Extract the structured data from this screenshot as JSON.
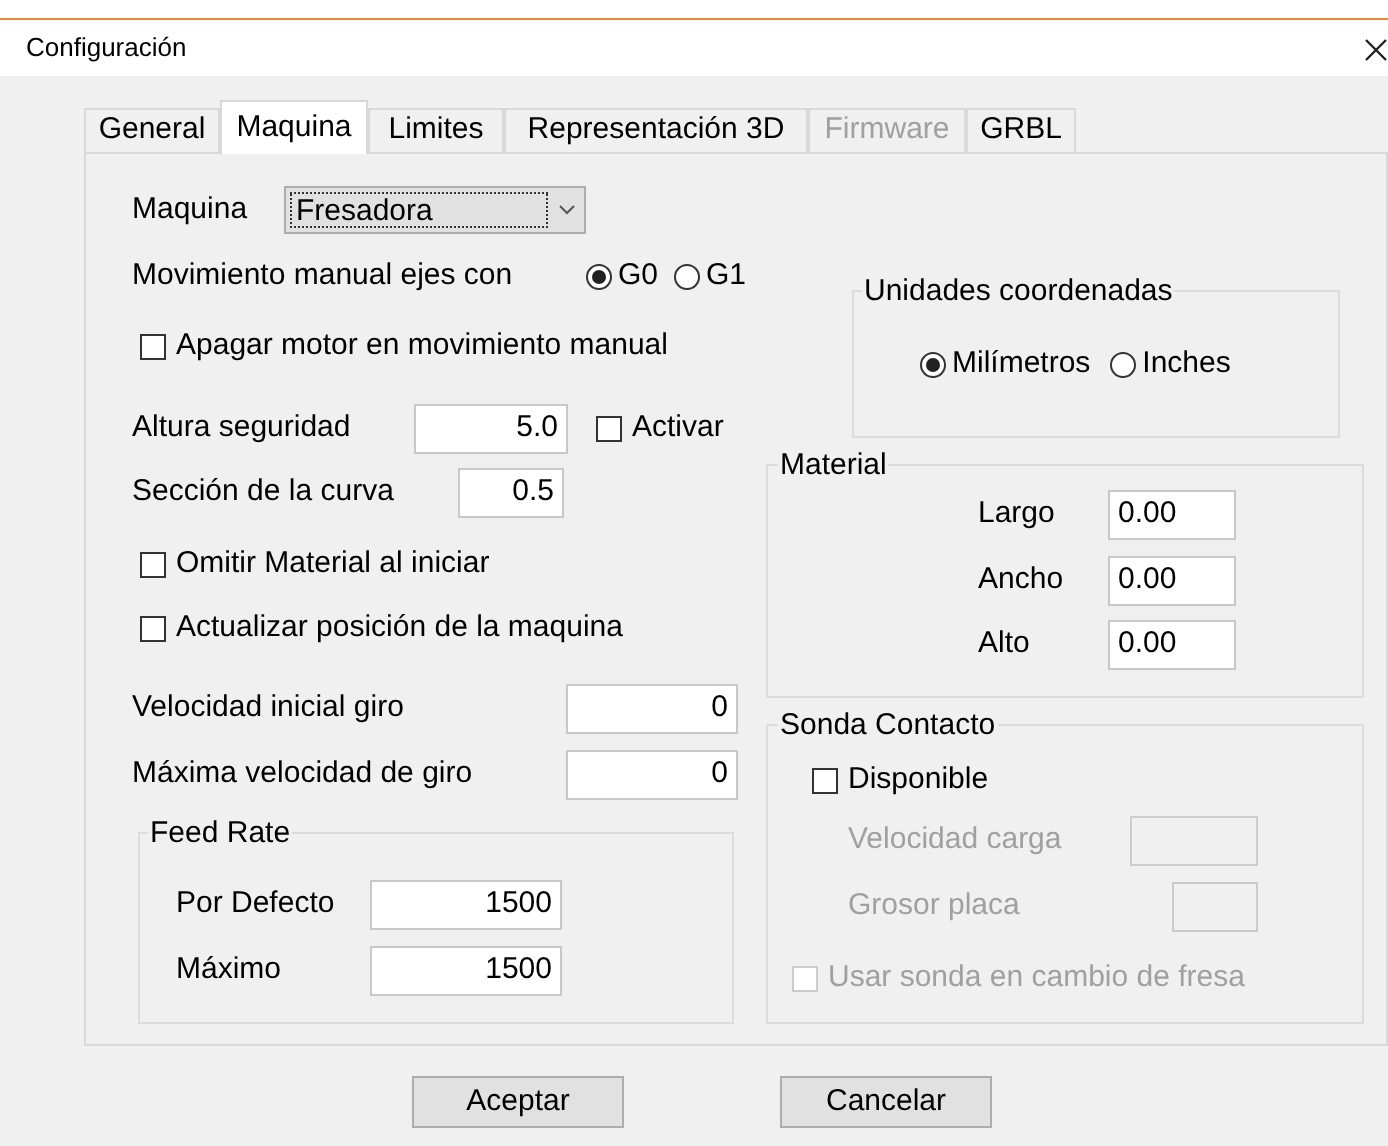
{
  "window": {
    "title": "Configuración"
  },
  "tabs": [
    {
      "label": "General",
      "selected": false,
      "disabled": false
    },
    {
      "label": "Maquina",
      "selected": true,
      "disabled": false
    },
    {
      "label": "Limites",
      "selected": false,
      "disabled": false
    },
    {
      "label": "Representación 3D",
      "selected": false,
      "disabled": false
    },
    {
      "label": "Firmware",
      "selected": false,
      "disabled": true
    },
    {
      "label": "GRBL",
      "selected": false,
      "disabled": false
    }
  ],
  "machine": {
    "label": "Maquina",
    "value": "Fresadora"
  },
  "movement": {
    "label": "Movimiento manual ejes con",
    "options": [
      {
        "label": "G0",
        "selected": true
      },
      {
        "label": "G1",
        "selected": false
      }
    ]
  },
  "motor_off": {
    "label": "Apagar motor en movimiento manual",
    "checked": false
  },
  "safety_height": {
    "label": "Altura seguridad",
    "value": "5.0",
    "activate": {
      "label": "Activar",
      "checked": false
    }
  },
  "curve_section": {
    "label": "Sección de la curva",
    "value": "0.5"
  },
  "skip_material": {
    "label": "Omitir Material al iniciar",
    "checked": false
  },
  "update_position": {
    "label": "Actualizar posición de la maquina",
    "checked": false
  },
  "initial_speed": {
    "label": "Velocidad inicial giro",
    "value": "0"
  },
  "max_speed": {
    "label": "Máxima velocidad de giro",
    "value": "0"
  },
  "feed_rate": {
    "title": "Feed Rate",
    "fields": [
      {
        "label": "Por Defecto",
        "value": "1500"
      },
      {
        "label": "Máximo",
        "value": "1500"
      }
    ]
  },
  "units": {
    "title": "Unidades coordenadas",
    "options": [
      {
        "label": "Milímetros",
        "selected": true
      },
      {
        "label": "Inches",
        "selected": false
      }
    ]
  },
  "material": {
    "title": "Material",
    "fields": [
      {
        "label": "Largo",
        "value": "0.00"
      },
      {
        "label": "Ancho",
        "value": "0.00"
      },
      {
        "label": "Alto",
        "value": "0.00"
      }
    ]
  },
  "probe": {
    "title": "Sonda Contacto",
    "available": {
      "label": "Disponible",
      "checked": false
    },
    "fields": [
      {
        "label": "Velocidad carga",
        "disabled": true
      },
      {
        "label": "Grosor placa",
        "disabled": true
      }
    ],
    "tool_change": {
      "label": "Usar sonda en cambio de fresa",
      "checked": false,
      "disabled": true
    }
  },
  "buttons": [
    {
      "label": "Aceptar"
    },
    {
      "label": "Cancelar"
    }
  ]
}
